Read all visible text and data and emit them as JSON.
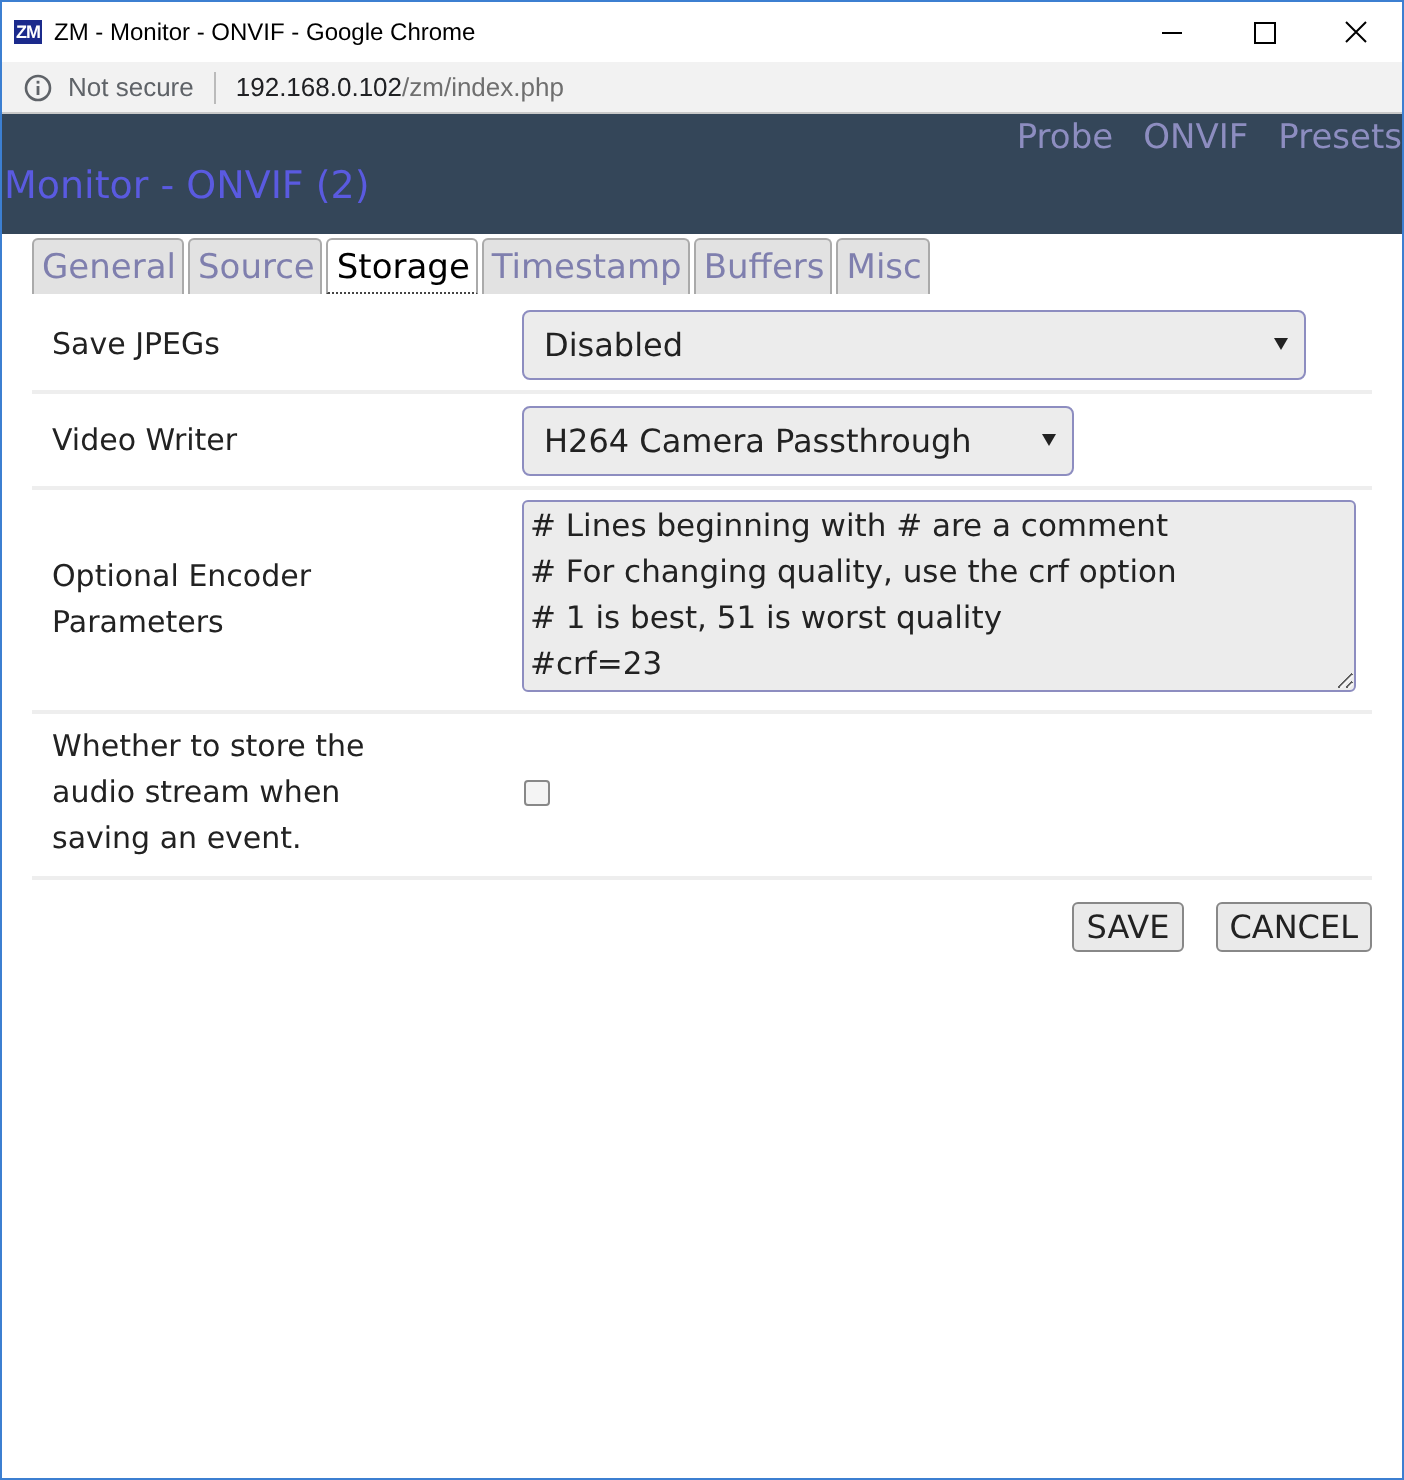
{
  "window": {
    "title": "ZM - Monitor - ONVIF - Google Chrome",
    "app_logo": "ZM"
  },
  "address_bar": {
    "security": "Not secure",
    "host": "192.168.0.102",
    "path": "/zm/index.php"
  },
  "header": {
    "title": "Monitor - ONVIF (2)",
    "links": [
      "Probe",
      "ONVIF",
      "Presets"
    ]
  },
  "tabs": [
    {
      "label": "General",
      "selected": false
    },
    {
      "label": "Source",
      "selected": false
    },
    {
      "label": "Storage",
      "selected": true
    },
    {
      "label": "Timestamp",
      "selected": false
    },
    {
      "label": "Buffers",
      "selected": false
    },
    {
      "label": "Misc",
      "selected": false
    }
  ],
  "fields": [
    {
      "kind": "select",
      "label": "Save JPEGs",
      "value": "Disabled",
      "wide": true
    },
    {
      "kind": "select",
      "label": "Video Writer",
      "value": "H264 Camera Passthrough",
      "wide": false
    },
    {
      "kind": "textarea",
      "label": "Optional Encoder Parameters",
      "value": "# Lines beginning with # are a comment\n# For changing quality, use the crf option\n# 1 is best, 51 is worst quality\n#crf=23"
    },
    {
      "kind": "checkbox",
      "label": "Whether to store the audio stream when saving an event.",
      "checked": false
    }
  ],
  "buttons": [
    "SAVE",
    "CANCEL"
  ]
}
